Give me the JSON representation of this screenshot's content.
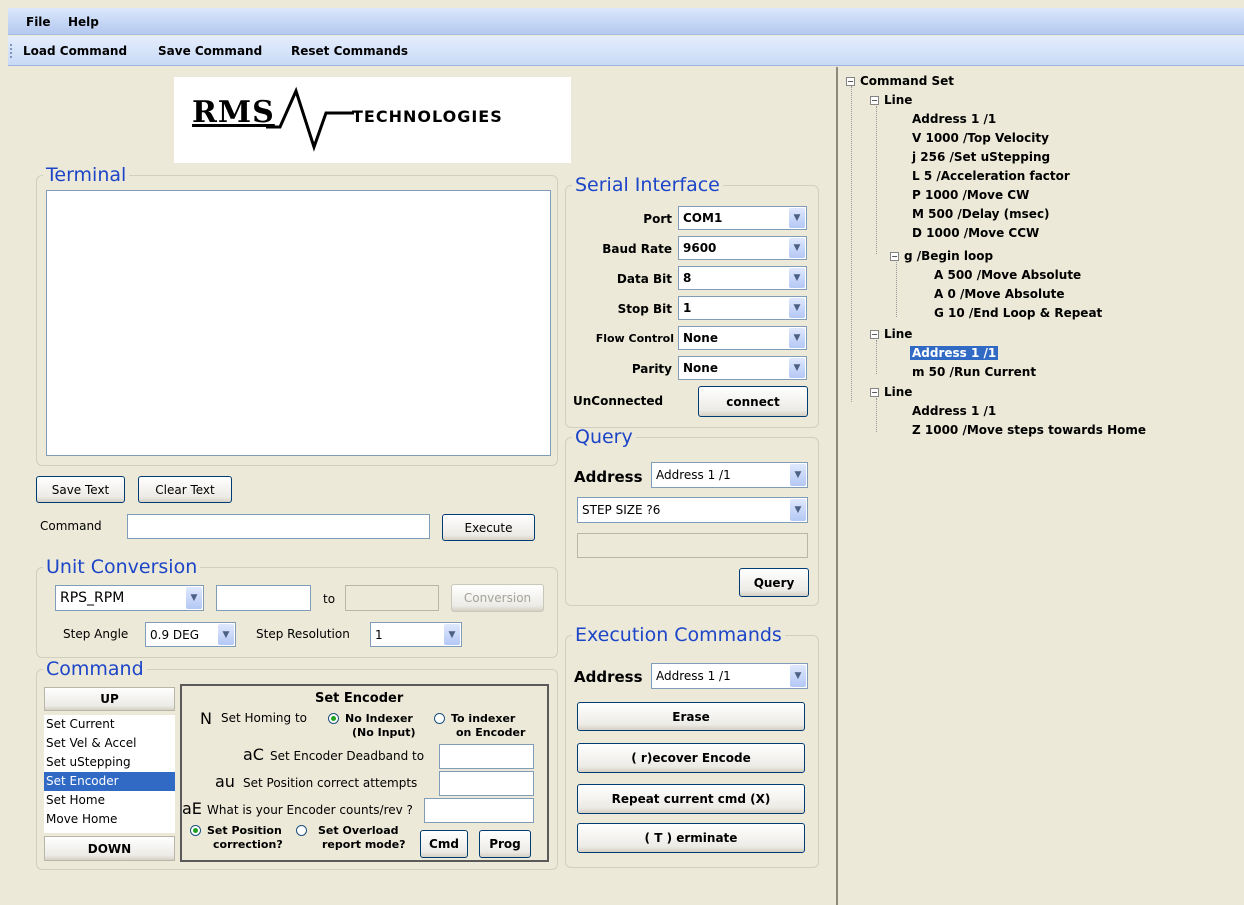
{
  "menu": {
    "file": "File",
    "help": "Help"
  },
  "toolbar": {
    "load": "Load Command",
    "save": "Save Command",
    "reset": "Reset Commands"
  },
  "logo": {
    "rms": "RMS",
    "tech": "TECHNOLOGIES"
  },
  "terminal": {
    "title": "Terminal",
    "save_text": "Save Text",
    "clear_text": "Clear Text",
    "command_label": "Command",
    "command_value": "",
    "execute": "Execute"
  },
  "unit_conversion": {
    "title": "Unit Conversion",
    "type": "RPS_RPM",
    "from_value": "",
    "to_label": "to",
    "to_value": "",
    "conversion": "Conversion",
    "step_angle_label": "Step Angle",
    "step_angle": "0.9 DEG",
    "step_res_label": "Step Resolution",
    "step_res": "1"
  },
  "command": {
    "title": "Command",
    "up": "UP",
    "down": "DOWN",
    "items": [
      "Set Current",
      "Set Vel & Accel",
      "Set uStepping",
      "Set Encoder",
      "Set Home",
      "Move Home"
    ],
    "selected": "Set Encoder"
  },
  "encoder": {
    "title": "Set Encoder",
    "n_code": "N",
    "homing_label": "Set Homing to",
    "opt_no_indexer": "No Indexer",
    "opt_no_indexer_sub": "(No Input)",
    "opt_to_indexer": "To indexer",
    "opt_to_indexer_sub": "on Encoder",
    "ac_code": "aC",
    "ac_label": "Set Encoder Deadband to",
    "au_code": "au",
    "au_label": "Set Position correct attempts",
    "ae_code": "aE",
    "ae_label": "What is your Encoder counts/rev ?",
    "opt_pos_corr": "Set Position",
    "opt_pos_corr_sub": "correction?",
    "opt_overload": "Set Overload",
    "opt_overload_sub": "report mode?",
    "cmd": "Cmd",
    "prog": "Prog"
  },
  "serial": {
    "title": "Serial Interface",
    "port_label": "Port",
    "port": "COM1",
    "baud_label": "Baud Rate",
    "baud": "9600",
    "data_label": "Data Bit",
    "data": "8",
    "stop_label": "Stop Bit",
    "stop": "1",
    "flow_label": "Flow Control",
    "flow": "None",
    "parity_label": "Parity",
    "parity": "None",
    "status": "UnConnected",
    "connect": "connect"
  },
  "query": {
    "title": "Query",
    "address_label": "Address",
    "address": "Address 1 /1",
    "query_cmd": "STEP SIZE ?6",
    "result": "",
    "button": "Query"
  },
  "execution": {
    "title": "Execution Commands",
    "address_label": "Address",
    "address": "Address 1 /1",
    "erase": "Erase",
    "recover": "( r)ecover Encode",
    "repeat": "Repeat current cmd (X)",
    "terminate": "( T ) erminate"
  },
  "tree": {
    "root": "Command Set",
    "line1": "Line",
    "l1_items": [
      "Address 1 /1",
      "V 1000 /Top Velocity",
      "j 256 /Set uStepping",
      "L 5 /Acceleration factor",
      "P 1000 /Move CW",
      "M 500 /Delay (msec)",
      "D 1000 /Move CCW"
    ],
    "loop": "g /Begin loop",
    "loop_items": [
      "A 500 /Move Absolute",
      "A 0 /Move Absolute",
      "G 10 /End Loop & Repeat"
    ],
    "line2": "Line",
    "l2_items": [
      "Address 1 /1",
      "m 50 /Run Current"
    ],
    "line3": "Line",
    "l3_items": [
      "Address 1 /1",
      "Z 1000 /Move steps towards Home"
    ]
  }
}
